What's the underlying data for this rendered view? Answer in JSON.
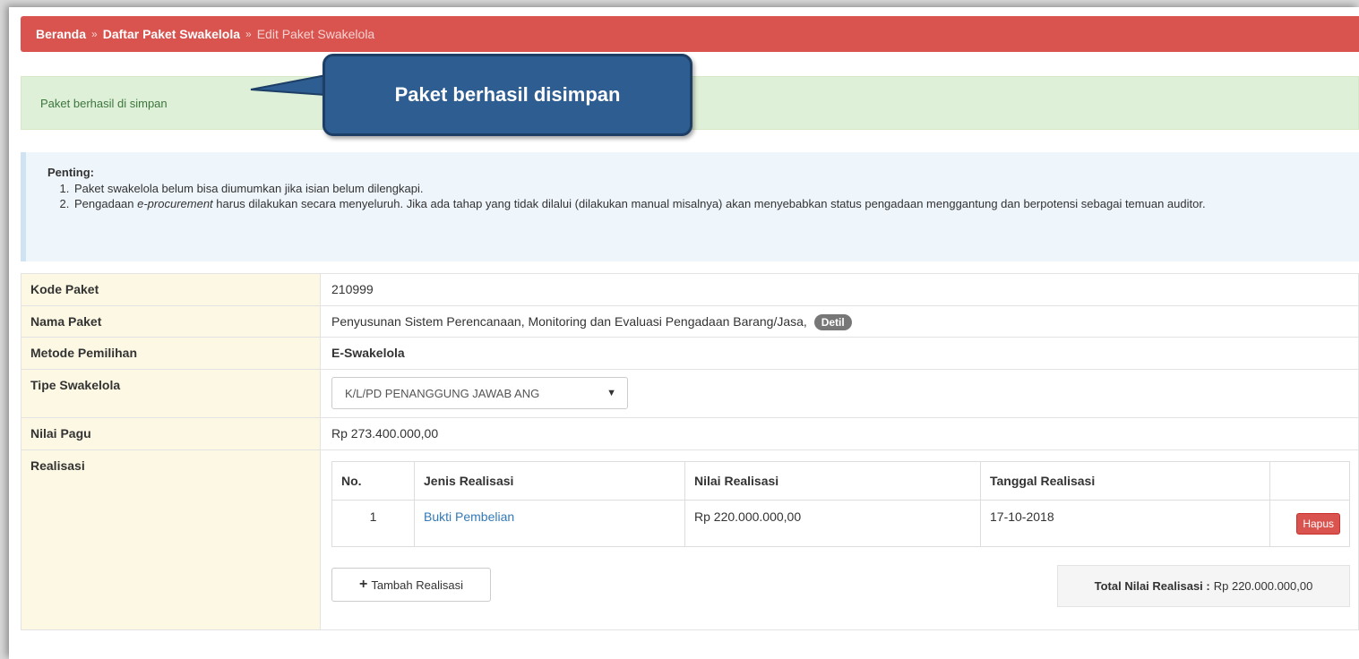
{
  "breadcrumb": {
    "items": [
      "Beranda",
      "Daftar Paket Swakelola",
      "Edit Paket Swakelola"
    ],
    "separator": "»"
  },
  "success_alert": "Paket berhasil di simpan",
  "callout": "Paket berhasil disimpan",
  "info": {
    "title": "Penting:",
    "item1": "Paket swakelola belum bisa diumumkan jika isian belum dilengkapi.",
    "item2_pre": "Pengadaan ",
    "item2_em": "e-procurement",
    "item2_post": " harus dilakukan secara menyeluruh. Jika ada tahap yang tidak dilalui (dilakukan manual misalnya) akan menyebabkan status pengadaan menggantung dan berpotensi sebagai temuan auditor."
  },
  "form": {
    "kode_label": "Kode Paket",
    "kode_value": "210999",
    "nama_label": "Nama Paket",
    "nama_value": "Penyusunan Sistem Perencanaan, Monitoring dan Evaluasi Pengadaan Barang/Jasa,",
    "detil_label": "Detil",
    "metode_label": "Metode Pemilihan",
    "metode_value": "E-Swakelola",
    "tipe_label": "Tipe Swakelola",
    "tipe_value": "K/L/PD PENANGGUNG JAWAB ANG",
    "pagu_label": "Nilai Pagu",
    "pagu_value": "Rp 273.400.000,00",
    "realisasi_label": "Realisasi"
  },
  "realisasi": {
    "headers": [
      "No.",
      "Jenis Realisasi",
      "Nilai Realisasi",
      "Tanggal Realisasi",
      ""
    ],
    "rows": [
      {
        "no": "1",
        "jenis": "Bukti Pembelian",
        "nilai": "Rp 220.000.000,00",
        "tanggal": "17-10-2018",
        "action": "Hapus"
      }
    ],
    "add_button": "Tambah Realisasi",
    "total_label": "Total Nilai Realisasi :",
    "total_value": "Rp 220.000.000,00"
  },
  "colors": {
    "breadcrumb_bg": "#d9534f",
    "callout_bg": "#2e5d91",
    "success_bg": "#dff0d8",
    "info_bg": "#eef5fb",
    "label_bg": "#fcf8e3",
    "link": "#337ab7"
  }
}
